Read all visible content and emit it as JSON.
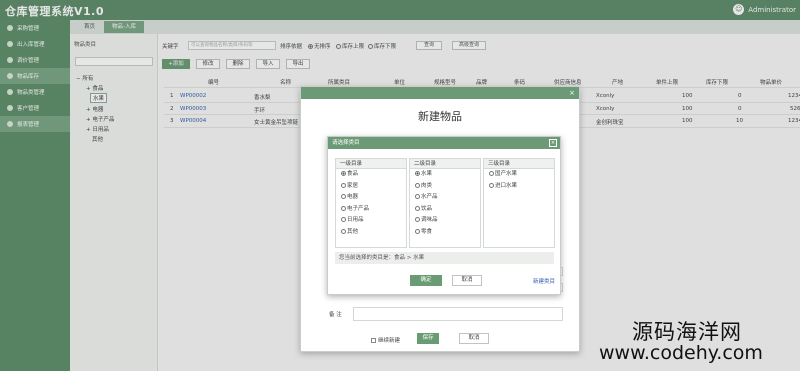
{
  "app": {
    "title": "仓库管理系统V1.0",
    "user": "Administrator"
  },
  "sidebar": {
    "items": [
      {
        "label": "采购管理"
      },
      {
        "label": "出入库管理"
      },
      {
        "label": "调价管理"
      },
      {
        "label": "物品库存"
      },
      {
        "label": "物品类管理"
      },
      {
        "label": "客户管理"
      },
      {
        "label": "报表管理"
      }
    ]
  },
  "tabs": [
    {
      "label": "首页"
    },
    {
      "label": "物品-入库"
    }
  ],
  "tree": {
    "title": "物品类目",
    "items": [
      {
        "label": "所有"
      },
      {
        "label": "食品"
      },
      {
        "label": "水果"
      },
      {
        "label": "电器"
      },
      {
        "label": "电子产品"
      },
      {
        "label": "日用品"
      },
      {
        "label": "其他"
      }
    ]
  },
  "filters": {
    "keyword_label": "关键字",
    "keyword_placeholder": "可以查询物品名称/类目/条码等",
    "sort_label": "排序依据",
    "sort_options": [
      {
        "label": "无排序"
      },
      {
        "label": "库存上限"
      },
      {
        "label": "库存下限"
      }
    ],
    "query_btn": "查询",
    "advanced_btn": "高级查询"
  },
  "actions": {
    "add": "+添加",
    "edit": "修改",
    "delete": "删除",
    "import": "导入",
    "export": "导出"
  },
  "table": {
    "headers": [
      "编号",
      "名称",
      "所属类目",
      "单位",
      "规格型号",
      "品牌",
      "条码",
      "供应商信息",
      "产地",
      "单件上限",
      "库存下限",
      "物品单价"
    ],
    "rows": [
      {
        "index": "1",
        "code": "WP00002",
        "name": "香水梨",
        "origin": "Xconly",
        "upper": "100",
        "lower": "0",
        "price": "1234"
      },
      {
        "index": "2",
        "code": "WP00003",
        "name": "手环",
        "origin": "Xconly",
        "upper": "100",
        "lower": "0",
        "price": "526"
      },
      {
        "index": "3",
        "code": "WP00004",
        "name": "女士黄金吊坠项链",
        "origin": "金创利珠宝",
        "upper": "100",
        "lower": "10",
        "price": "1234"
      }
    ]
  },
  "modal": {
    "title": "新建物品",
    "remark_label": "备  注",
    "continue_label": "继续新建",
    "save_btn": "保存",
    "cancel_btn": "取消"
  },
  "category_dialog": {
    "title": "请选择类目",
    "col1": {
      "head": "一级目录",
      "options": [
        "食品",
        "家居",
        "电器",
        "电子产品",
        "日用品",
        "其他"
      ]
    },
    "col2": {
      "head": "二级目录",
      "options": [
        "水果",
        "肉类",
        "水产品",
        "饮品",
        "调味品",
        "零食"
      ]
    },
    "col3": {
      "head": "三级目录",
      "options": [
        "国产水果",
        "进口水果"
      ]
    },
    "selected_text": "您当前选择的类目是：食品 > 水果",
    "confirm_btn": "确定",
    "cancel_btn": "取消",
    "new_link": "新建类目"
  },
  "watermark": {
    "line1": "源码海洋网",
    "line2": "www.codehy.com"
  }
}
